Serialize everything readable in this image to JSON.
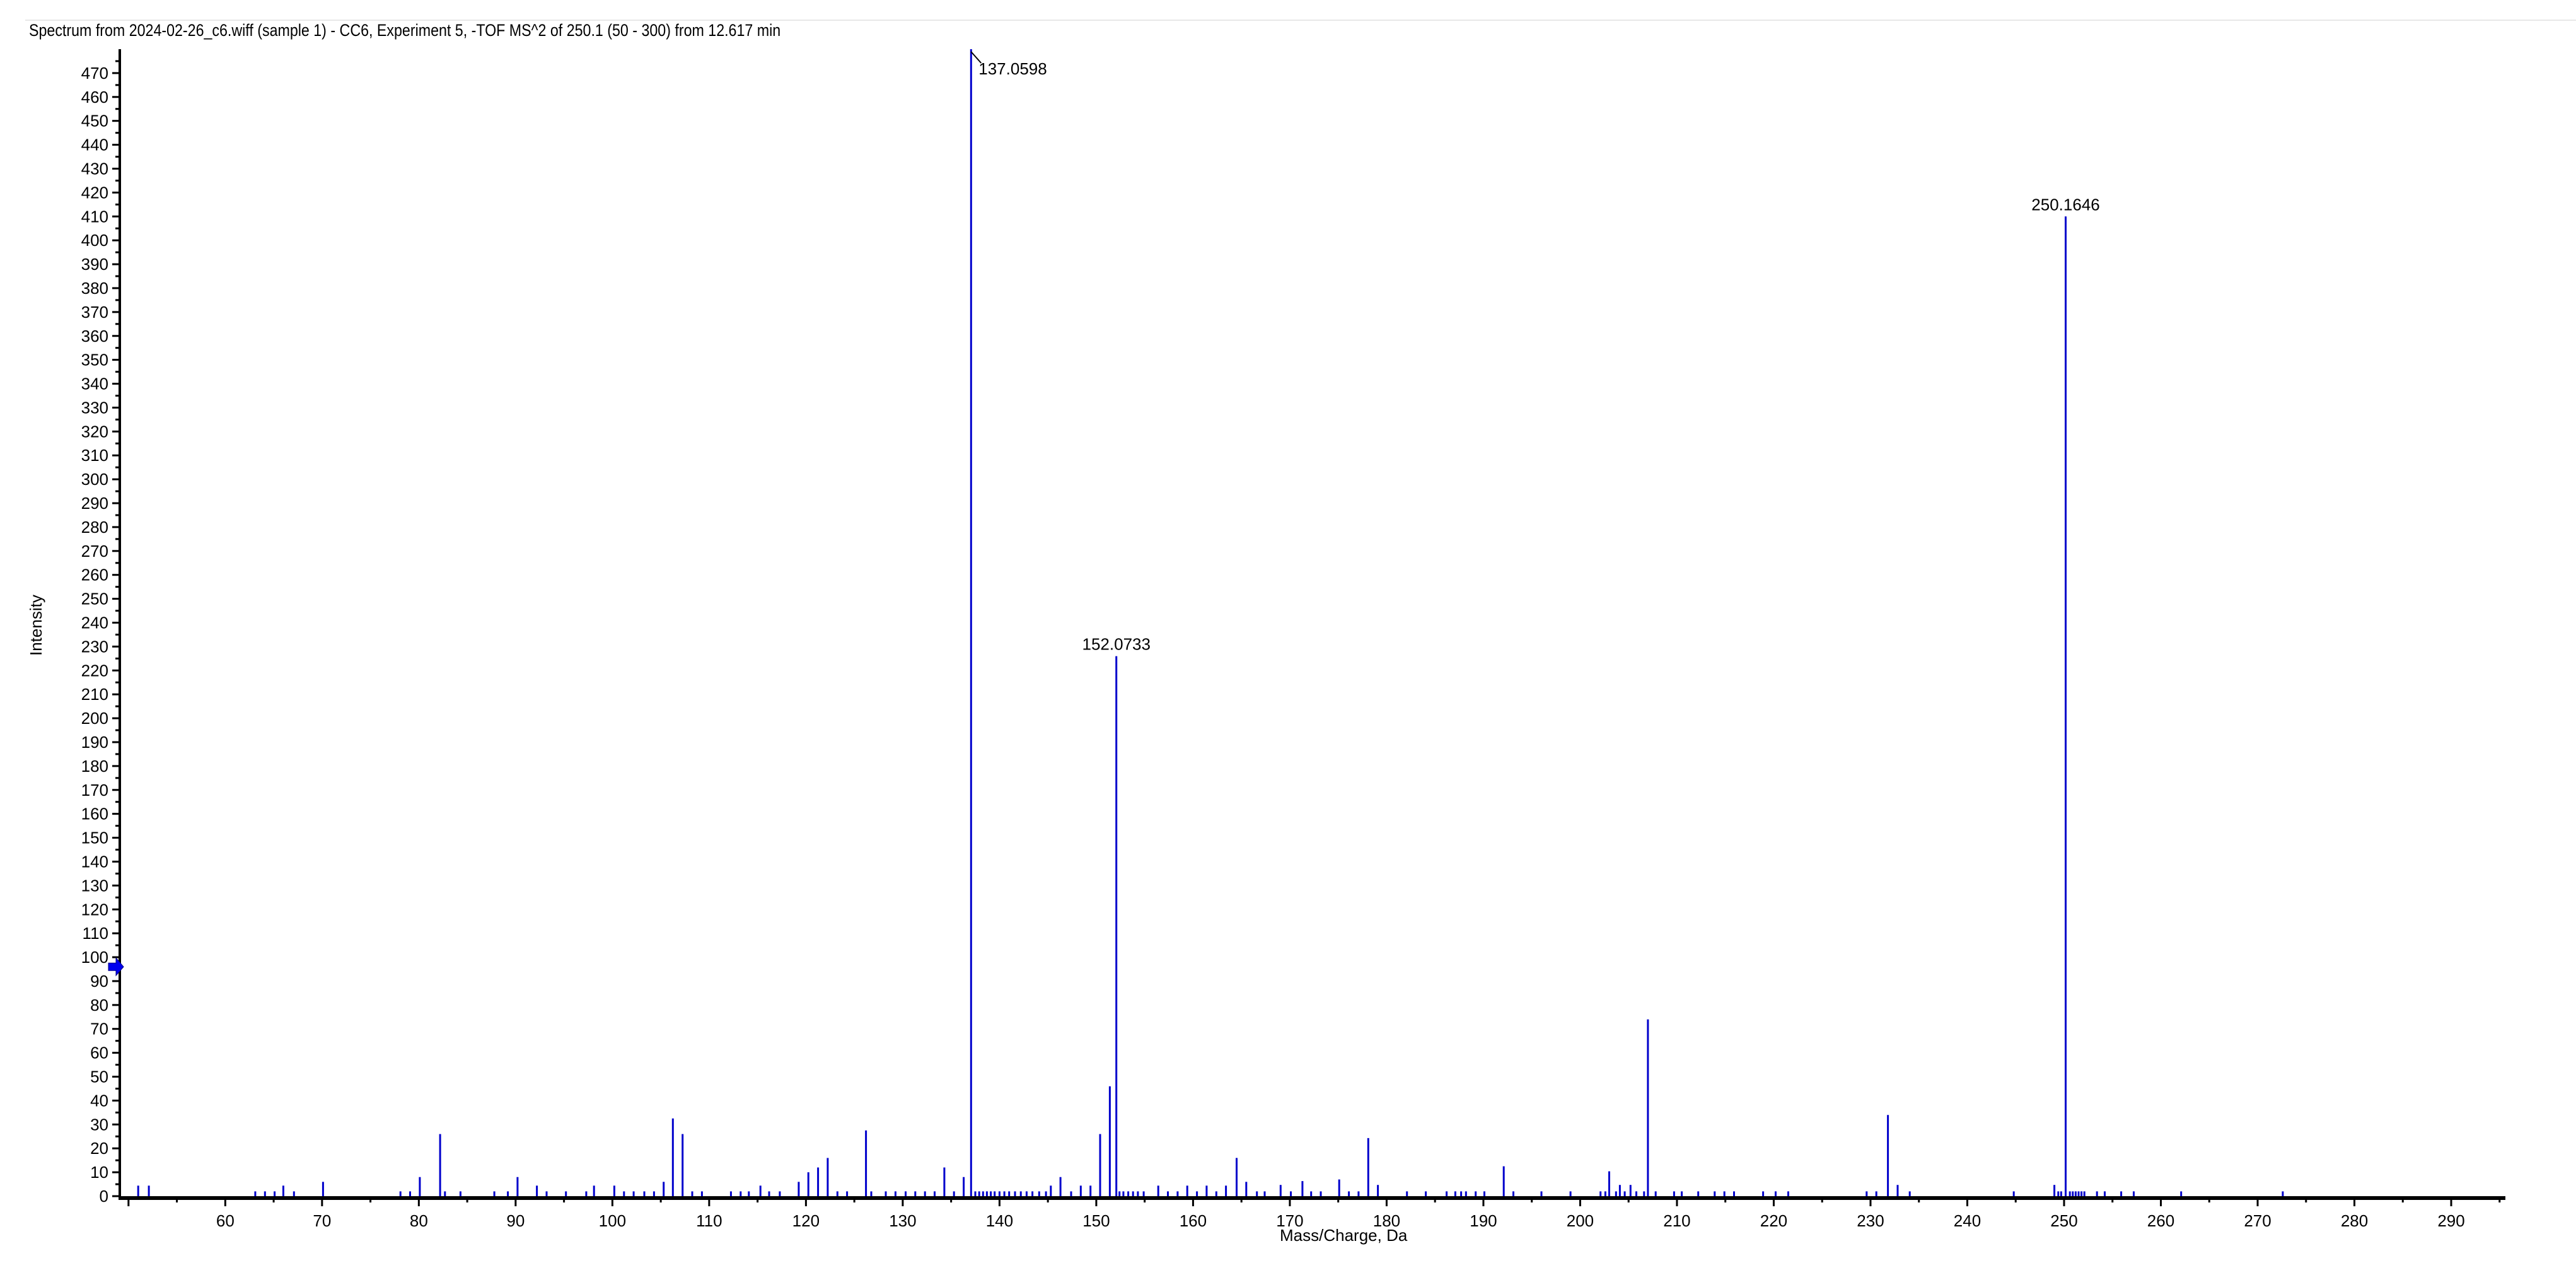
{
  "window": {
    "title": "Spectrum from 2024-02-26_c6.wiff (sample 1) - CC6, Experiment 5, -TOF MS^2 of 250.1 (50 - 300) from 12.617 min"
  },
  "chart_data": {
    "type": "bar",
    "title": "Spectrum from 2024-02-26_c6.wiff (sample 1) - CC6, Experiment 5, -TOF MS^2 of 250.1 (50 - 300) from 12.617 min",
    "xlabel": "Mass/Charge, Da",
    "ylabel": "Intensity",
    "xlim": [
      49.1,
      295.6
    ],
    "ylim": [
      0,
      480
    ],
    "grid": false,
    "series_color": "#0000cc",
    "x_ticks": [
      "60",
      "70",
      "80",
      "90",
      "100",
      "110",
      "120",
      "130",
      "140",
      "150",
      "160",
      "170",
      "180",
      "190",
      "200",
      "210",
      "220",
      "230",
      "240",
      "250",
      "260",
      "270",
      "280",
      "290"
    ],
    "y_ticks": [
      "0",
      "10",
      "20",
      "30",
      "40",
      "50",
      "60",
      "70",
      "80",
      "90",
      "100",
      "110",
      "120",
      "130",
      "140",
      "150",
      "160",
      "170",
      "180",
      "190",
      "200",
      "210",
      "220",
      "230",
      "240",
      "250",
      "260",
      "270",
      "280",
      "290",
      "300",
      "310",
      "320",
      "330",
      "340",
      "350",
      "360",
      "370",
      "380",
      "390",
      "400",
      "410",
      "420",
      "430",
      "440",
      "450",
      "460",
      "470"
    ],
    "threshold_marker": 96,
    "labeled_peaks": [
      {
        "mz": 137.0598,
        "intensity": 480,
        "label": "137.0598"
      },
      {
        "mz": 152.0733,
        "intensity": 226,
        "label": "152.0733"
      },
      {
        "mz": 250.1646,
        "intensity": 410,
        "label": "250.1646"
      }
    ],
    "peaks": [
      [
        51.0,
        4.4
      ],
      [
        52.1,
        4.4
      ],
      [
        63.1,
        2
      ],
      [
        64.1,
        2
      ],
      [
        65.1,
        2
      ],
      [
        66.0,
        4.4
      ],
      [
        67.1,
        2
      ],
      [
        70.1,
        6
      ],
      [
        78.1,
        2
      ],
      [
        79.1,
        2
      ],
      [
        80.1,
        8
      ],
      [
        82.2,
        26
      ],
      [
        82.7,
        2
      ],
      [
        84.3,
        2
      ],
      [
        87.8,
        2
      ],
      [
        89.2,
        2
      ],
      [
        90.2,
        8
      ],
      [
        92.2,
        4.4
      ],
      [
        93.2,
        2
      ],
      [
        95.2,
        2
      ],
      [
        97.3,
        2
      ],
      [
        98.1,
        4.4
      ],
      [
        100.2,
        4.4
      ],
      [
        101.2,
        2
      ],
      [
        102.2,
        2
      ],
      [
        103.3,
        2
      ],
      [
        104.3,
        2
      ],
      [
        105.3,
        6
      ],
      [
        106.25,
        32.5
      ],
      [
        107.25,
        26
      ],
      [
        108.25,
        2
      ],
      [
        109.25,
        2
      ],
      [
        112.25,
        2
      ],
      [
        113.25,
        2
      ],
      [
        114.1,
        2
      ],
      [
        115.3,
        4.4
      ],
      [
        116.2,
        2
      ],
      [
        117.3,
        2
      ],
      [
        119.25,
        6
      ],
      [
        120.25,
        10
      ],
      [
        121.25,
        12
      ],
      [
        122.25,
        16
      ],
      [
        123.25,
        2
      ],
      [
        124.25,
        2
      ],
      [
        126.2,
        27.5
      ],
      [
        126.75,
        2
      ],
      [
        128.25,
        2
      ],
      [
        129.25,
        2
      ],
      [
        130.3,
        2
      ],
      [
        131.3,
        2
      ],
      [
        132.3,
        2
      ],
      [
        133.3,
        2
      ],
      [
        134.3,
        12
      ],
      [
        135.3,
        2
      ],
      [
        136.3,
        8
      ],
      [
        137.0598,
        480
      ],
      [
        137.5,
        2
      ],
      [
        137.9,
        2
      ],
      [
        138.3,
        2
      ],
      [
        138.7,
        2
      ],
      [
        139.1,
        2
      ],
      [
        139.5,
        2
      ],
      [
        140.0,
        2
      ],
      [
        140.5,
        2
      ],
      [
        141.0,
        2
      ],
      [
        141.6,
        2
      ],
      [
        142.2,
        2
      ],
      [
        142.8,
        2
      ],
      [
        143.4,
        2
      ],
      [
        144.1,
        2
      ],
      [
        144.8,
        2
      ],
      [
        145.3,
        4.4
      ],
      [
        146.3,
        8
      ],
      [
        147.4,
        2
      ],
      [
        148.4,
        4.4
      ],
      [
        149.4,
        4.4
      ],
      [
        150.4,
        26
      ],
      [
        151.4,
        46
      ],
      [
        152.0733,
        226
      ],
      [
        152.4,
        2
      ],
      [
        152.8,
        2
      ],
      [
        153.3,
        2
      ],
      [
        153.8,
        2
      ],
      [
        154.3,
        2
      ],
      [
        154.9,
        2
      ],
      [
        156.4,
        4.4
      ],
      [
        157.4,
        2
      ],
      [
        158.4,
        2
      ],
      [
        159.4,
        4.4
      ],
      [
        160.4,
        2
      ],
      [
        161.4,
        4.4
      ],
      [
        162.4,
        2
      ],
      [
        163.4,
        4.4
      ],
      [
        164.5,
        16
      ],
      [
        165.5,
        6
      ],
      [
        166.6,
        2
      ],
      [
        167.4,
        2
      ],
      [
        169.05,
        4.7
      ],
      [
        170.1,
        2
      ],
      [
        171.3,
        6.3
      ],
      [
        172.2,
        2
      ],
      [
        173.2,
        2
      ],
      [
        175.1,
        7
      ],
      [
        176.1,
        2
      ],
      [
        177.1,
        2
      ],
      [
        178.1,
        24.3
      ],
      [
        179.1,
        4.7
      ],
      [
        182.1,
        2
      ],
      [
        184.05,
        2
      ],
      [
        186.2,
        2
      ],
      [
        187.1,
        2
      ],
      [
        187.7,
        2
      ],
      [
        188.2,
        2
      ],
      [
        189.2,
        2
      ],
      [
        190.1,
        2
      ],
      [
        192.1,
        12.5
      ],
      [
        193.1,
        2
      ],
      [
        196.0,
        2
      ],
      [
        199.0,
        2
      ],
      [
        202.1,
        2
      ],
      [
        202.6,
        2
      ],
      [
        203.0,
        10.4
      ],
      [
        203.7,
        2
      ],
      [
        204.1,
        4.7
      ],
      [
        204.6,
        2
      ],
      [
        205.2,
        4.7
      ],
      [
        205.8,
        2
      ],
      [
        206.6,
        2
      ],
      [
        207.0,
        74
      ],
      [
        207.8,
        2
      ],
      [
        209.7,
        2
      ],
      [
        210.5,
        2
      ],
      [
        212.2,
        2
      ],
      [
        213.9,
        2
      ],
      [
        214.9,
        2
      ],
      [
        215.9,
        2
      ],
      [
        218.9,
        2
      ],
      [
        220.2,
        2
      ],
      [
        221.5,
        2
      ],
      [
        229.6,
        2
      ],
      [
        230.6,
        2
      ],
      [
        231.8,
        34
      ],
      [
        232.8,
        4.7
      ],
      [
        234.05,
        2
      ],
      [
        244.8,
        2
      ],
      [
        249.0,
        4.7
      ],
      [
        249.4,
        2
      ],
      [
        249.7,
        2
      ],
      [
        250.1646,
        410
      ],
      [
        250.6,
        2
      ],
      [
        250.9,
        2
      ],
      [
        251.2,
        2
      ],
      [
        251.5,
        2
      ],
      [
        251.8,
        2
      ],
      [
        252.1,
        2
      ],
      [
        253.4,
        2
      ],
      [
        254.2,
        2
      ],
      [
        255.9,
        2
      ],
      [
        257.2,
        2
      ],
      [
        262.1,
        2
      ],
      [
        272.6,
        2
      ]
    ]
  }
}
